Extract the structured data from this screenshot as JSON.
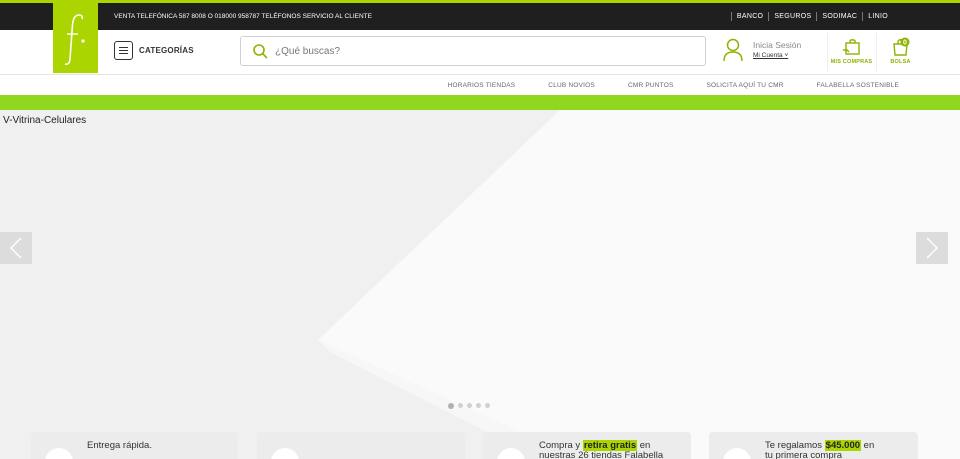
{
  "topbar": {
    "phone_text": "VENTA TELEFÓNICA 587 8008 O 018000 958787   TELÉFONOS SERVICIO AL CLIENTE",
    "links": [
      "BANCO",
      "SEGUROS",
      "SODIMAC",
      "LINIO"
    ]
  },
  "header": {
    "logo_letter": "f.",
    "categories_label": "CATEGORÍAS",
    "search_placeholder": "¿Qué buscas?",
    "account_title": "Inicia Sesión",
    "account_sub": "Mi Cuenta",
    "purchases_label": "MIS COMPRAS",
    "bag_label": "BOLSA",
    "bag_count": "0"
  },
  "nav2": {
    "links": [
      "HORARIOS TIENDAS",
      "CLUB NOVIOS",
      "CMR PUNTOS",
      "SOLICITA AQUÍ TU CMR",
      "FALABELLA SOSTENIBLE"
    ]
  },
  "hero": {
    "alt_text": "V-Vitrina-Celulares",
    "slide_count": 5,
    "active_slide": 1
  },
  "cards": [
    {
      "line1": "Entrega rápida.",
      "line2": ""
    },
    {
      "line1": "",
      "line2": ""
    },
    {
      "pre": "Compra y ",
      "highlight": "retira gratis",
      "post": " en",
      "line2": "nuestras 26 tiendas Falabella"
    },
    {
      "pre": "Te regalamos ",
      "highlight": "$45.000",
      "post": " en",
      "line2": "tu primera compra"
    }
  ],
  "colors": {
    "brand_green": "#aad500",
    "band_green": "#8fd81f",
    "topbar": "#1f1f1f"
  },
  "icons": [
    "search-icon",
    "user-icon",
    "purchases-icon",
    "bag-icon",
    "chevron-left-icon",
    "chevron-right-icon",
    "menu-icon"
  ]
}
